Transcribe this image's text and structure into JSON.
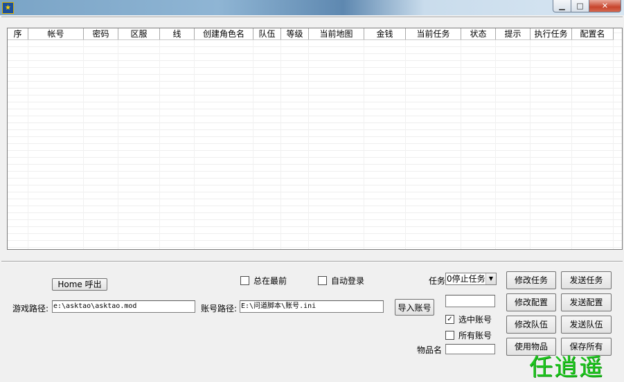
{
  "window": {
    "app_icon": "app-icon",
    "min_glyph": "▁",
    "max_glyph": "□",
    "close_glyph": "✕"
  },
  "table": {
    "columns": [
      "序",
      "帐号",
      "密码",
      "区服",
      "线",
      "创建角色名",
      "队伍",
      "等级",
      "当前地图",
      "金钱",
      "当前任务",
      "状态",
      "提示",
      "执行任务",
      "配置名"
    ]
  },
  "controls": {
    "home_button": "Home 呼出",
    "always_on_top": {
      "label": "总在最前",
      "checked": false
    },
    "auto_login": {
      "label": "自动登录",
      "checked": false
    },
    "task_label": "任务",
    "task_select": "0停止任务",
    "game_path_label": "游戏路径:",
    "game_path_value": "e:\\asktao\\asktao.mod",
    "account_path_label": "账号路径:",
    "account_path_value": "E:\\问道脚本\\账号.ini",
    "import_button": "导入账号",
    "selected_account": {
      "label": "选中账号",
      "checked": true
    },
    "all_accounts": {
      "label": "所有账号",
      "checked": false
    },
    "item_name_label": "物品名",
    "buttons": {
      "modify_task": "修改任务",
      "send_task": "发送任务",
      "modify_config": "修改配置",
      "send_config": "发送配置",
      "modify_team": "修改队伍",
      "send_team": "发送队伍",
      "use_item": "使用物品",
      "save_all": "保存所有"
    }
  },
  "watermark": "任逍遥"
}
